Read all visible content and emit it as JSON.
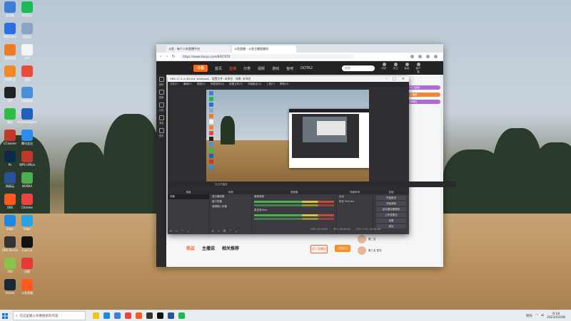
{
  "desktop": {
    "icons": [
      {
        "label": "此电脑",
        "color": "#3d7fd6"
      },
      {
        "label": "QQ音乐",
        "color": "#1db954"
      },
      {
        "label": "WeGame",
        "color": "#2d6fe0"
      },
      {
        "label": "回收站",
        "color": "#8aa4c2"
      },
      {
        "label": "游戏加速",
        "color": "#f07b22"
      },
      {
        "label": "文件",
        "color": "#f5f5f5"
      },
      {
        "label": "迅雷影音",
        "color": "#f08a24"
      },
      {
        "label": "文档",
        "color": "#e84a3c"
      },
      {
        "label": "QQ",
        "color": "#222"
      },
      {
        "label": "控制面板",
        "color": "#4a90d9"
      },
      {
        "label": "微信",
        "color": "#2bbf4a"
      },
      {
        "label": "Malwarebytes",
        "color": "#1e5fbf"
      },
      {
        "label": "CCleaner",
        "color": "#c0392b"
      },
      {
        "label": "腾讯会议",
        "color": "#2d8cf0"
      },
      {
        "label": "Ps",
        "color": "#0b2a4a"
      },
      {
        "label": "WPS Office",
        "color": "#c0392b"
      },
      {
        "label": "网易云",
        "color": "#2a5298"
      },
      {
        "label": "NVIDIA",
        "color": "#4caf50"
      },
      {
        "label": "OBS",
        "color": "#ff5a1e"
      },
      {
        "label": "Chrome",
        "color": "#e8453c"
      },
      {
        "label": "Edge",
        "color": "#1e88e5"
      },
      {
        "label": "Edge",
        "color": "#2aa3e0"
      },
      {
        "label": "OBS Studio",
        "color": "#333"
      },
      {
        "label": "CapCut",
        "color": "#111"
      },
      {
        "label": "360",
        "color": "#8bc34a"
      },
      {
        "label": "迅雷",
        "color": "#e53935"
      },
      {
        "label": "Steam",
        "color": "#1b2838"
      },
      {
        "label": "斗鱼直播",
        "color": "#ff5a1e"
      }
    ]
  },
  "taskbar": {
    "search_placeholder": "在这里输入你要搜索的内容",
    "weather": "阴天",
    "time": "9:18",
    "date": "2023/03/08",
    "app_colors": [
      "#f1c40f",
      "#1e88e5",
      "#3d7fd6",
      "#e8453c",
      "#ff5a1e",
      "#333",
      "#111",
      "#2a5298",
      "#1db954"
    ]
  },
  "browser": {
    "tabs": [
      "斗鱼 - 每个人的直播平台",
      "斗鱼直播 - 斗鱼主播直播间"
    ],
    "url": "https://www.douyu.com/8407070",
    "site": {
      "logo": "斗鱼",
      "nav": [
        "首页",
        "直播",
        "分类",
        "视频",
        "游戏",
        "鱼吧",
        "DOTA2"
      ],
      "search_placeholder": "搜索",
      "header_icons": [
        "历史",
        "关注",
        "私信",
        "客户端"
      ],
      "side_left": [
        "推荐",
        "直播",
        "分类",
        "消息",
        "更多"
      ],
      "bottom_tabs": [
        "热议",
        "主播说",
        "相关推荐"
      ],
      "btn_secondary": "进入直播间",
      "btn_primary": "立即关注",
      "pills": [
        "热门活动",
        "主播榜",
        "推荐位"
      ],
      "right_list": [
        "第二名",
        "第三名 暂无"
      ]
    }
  },
  "obs": {
    "title": "OBS 27.2.4 (64-bit, windows) - 配置文件: 未命名 - 场景: 未命名",
    "menu": [
      "文件(F)",
      "编辑(E)",
      "视图(V)",
      "停靠部件(D)",
      "配置文件(P)",
      "场景集合(S)",
      "工具(T)",
      "帮助(H)"
    ],
    "status_left": "无正在播放",
    "docks": {
      "scenes": {
        "title": "场景",
        "items": [
          "场景"
        ]
      },
      "sources": {
        "title": "来源",
        "items": [
          "显示器采集",
          "窗口采集",
          "音频输入采集"
        ]
      },
      "mixer": {
        "title": "混音器",
        "channels": [
          "桌面音频",
          "麦克风/Aux"
        ]
      },
      "transitions": {
        "title": "场景转场",
        "mode": "淡出",
        "duration_label": "时长",
        "duration": "300 ms"
      },
      "controls": {
        "title": "控制",
        "buttons": [
          "开始推流",
          "开始录制",
          "启动虚拟摄像机",
          "工作室模式",
          "设置",
          "退出"
        ]
      }
    },
    "footer": [
      "LIVE: 00:00:00",
      "REC: 00:00:00",
      "CPU: 3.4%, 30.00 fps"
    ]
  }
}
